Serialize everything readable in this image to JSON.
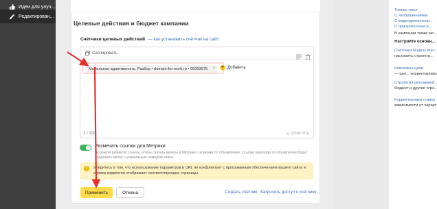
{
  "sidebar": {
    "items": [
      {
        "label": "Идеи для улуч...",
        "icon": "thumbs-up-icon",
        "active": false
      },
      {
        "label": "Редактирован...",
        "icon": "pencil-icon",
        "active": true
      }
    ]
  },
  "section": {
    "title": "Целевые действия и бюджет кампании",
    "counters_label": "Счётчики целевых действий",
    "counters_link": "— как установить счётчик на сайт"
  },
  "editor": {
    "copy_label": "Скопировать",
    "chip_text": "Мобильная адаптивность. Разбор • domain-for-work.ru • 65053075",
    "add_label": "Добавить",
    "counter_text": "1 / 100",
    "clear_label": "Очистить"
  },
  "metrika": {
    "toggle_on": true,
    "label": "Размечать ссылки для Метрики",
    "description": "Включите разметку ссылок, чтобы связать визиты в Метрике с кликами по объявлению. Ссылки перехода по объявлению будут содержать метку с уникальным номером клика."
  },
  "warning": {
    "text": "Убедитесь в том, что использование параметров в URL не конфликтует с программным обеспечением вашего сайта и сервер корректно отображает соответствующие страницы."
  },
  "actions": {
    "apply_label": "Применить",
    "cancel_label": "Отмена",
    "create_counter_label": "Создать счётчик",
    "request_access_label": "Запросить доступ к счётчику"
  },
  "right_panel": {
    "list": [
      "Только текст",
      "С изображениями",
      "С видеодополнени...",
      "С приоритетным р..."
    ],
    "note": "В кампании также мо...",
    "heading": "Настройте основн...",
    "items": [
      {
        "link": "Счётчики Яндекс.Мет...",
        "desc": "настроить стратеги..."
      },
      {
        "link": "Ключевые цели",
        "desc": "— цел... корректировка ставок..."
      },
      {
        "link": "Стратегия рекламной...",
        "desc": "бюджет и другие огра..."
      },
      {
        "link": "Корректировки ставок",
        "desc": "зависимости от характ..."
      }
    ]
  },
  "colors": {
    "sidebar": "#3f3f3f",
    "accent_yellow": "#ffdb4d",
    "toggle_green": "#3bb35e",
    "link_blue": "#3b6fb6",
    "warning_bg": "#fff3c5",
    "annotation_red": "#e8302a"
  }
}
